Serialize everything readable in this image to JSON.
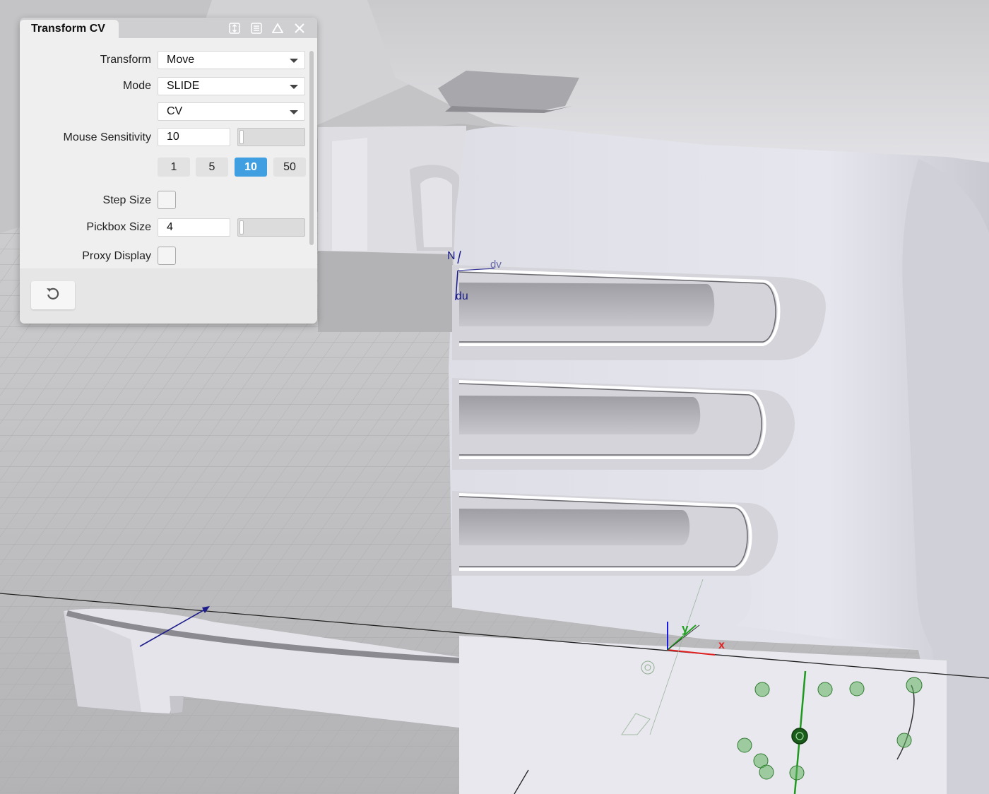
{
  "panel": {
    "title": "Transform CV",
    "titlebar_icons": [
      "pin-icon",
      "menu-icon",
      "collapse-icon",
      "close-icon"
    ],
    "transform": {
      "label": "Transform",
      "value": "Move"
    },
    "mode": {
      "label": "Mode",
      "value": "SLIDE"
    },
    "target": {
      "value": "CV"
    },
    "mouse_sensitivity": {
      "label": "Mouse Sensitivity",
      "value": "10"
    },
    "presets": [
      "1",
      "5",
      "10",
      "50"
    ],
    "active_preset": "10",
    "step_size": {
      "label": "Step Size",
      "checked": false
    },
    "pickbox_size": {
      "label": "Pickbox Size",
      "value": "4"
    },
    "proxy_display": {
      "label": "Proxy Display",
      "checked": false
    },
    "reset_icon": "reset-icon"
  },
  "viewport": {
    "uv_labels": {
      "n": "N",
      "dv": "dv",
      "du": "du"
    },
    "axis_labels": {
      "x": "x",
      "y": "y"
    },
    "colors": {
      "x_axis": "#e02020",
      "y_axis": "#1fa01f",
      "z_axis": "#1a1ae0",
      "cv_marker": "#3e9b3e",
      "active_preset": "#3f9fe0"
    }
  }
}
